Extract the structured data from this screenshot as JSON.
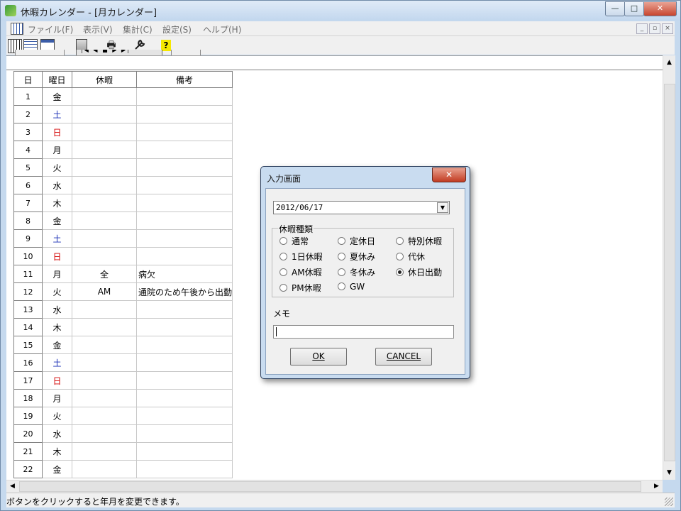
{
  "window": {
    "title": "休暇カレンダー - [月カレンダー]",
    "controls": {
      "minimize": "—",
      "maximize": "□",
      "close": "✕"
    }
  },
  "menu": {
    "items": [
      "ファイル(F)",
      "表示(V)",
      "集計(C)",
      "設定(S)",
      "ヘルプ(H)"
    ],
    "mdi": {
      "minimize": "_",
      "restore": "▫",
      "close": "×"
    }
  },
  "toolbar": {
    "print_glyph": "🖶",
    "help_glyph": "?",
    "nav_glyphs": "|◀ ◀ ■ ▶ ▶|"
  },
  "calendar": {
    "headers": [
      "日",
      "曜日",
      "休暇",
      "備考"
    ],
    "rows": [
      {
        "day": "1",
        "weekday": "金",
        "type": "",
        "vacation": "",
        "note": ""
      },
      {
        "day": "2",
        "weekday": "土",
        "type": "sat",
        "vacation": "",
        "note": ""
      },
      {
        "day": "3",
        "weekday": "日",
        "type": "sun",
        "vacation": "",
        "note": ""
      },
      {
        "day": "4",
        "weekday": "月",
        "type": "",
        "vacation": "",
        "note": ""
      },
      {
        "day": "5",
        "weekday": "火",
        "type": "",
        "vacation": "",
        "note": ""
      },
      {
        "day": "6",
        "weekday": "水",
        "type": "",
        "vacation": "",
        "note": ""
      },
      {
        "day": "7",
        "weekday": "木",
        "type": "",
        "vacation": "",
        "note": ""
      },
      {
        "day": "8",
        "weekday": "金",
        "type": "",
        "vacation": "",
        "note": ""
      },
      {
        "day": "9",
        "weekday": "土",
        "type": "sat",
        "vacation": "",
        "note": ""
      },
      {
        "day": "10",
        "weekday": "日",
        "type": "sun",
        "vacation": "",
        "note": ""
      },
      {
        "day": "11",
        "weekday": "月",
        "type": "",
        "vacation": "全",
        "note": "病欠"
      },
      {
        "day": "12",
        "weekday": "火",
        "type": "",
        "vacation": "AM",
        "note": "通院のため午後から出勤"
      },
      {
        "day": "13",
        "weekday": "水",
        "type": "",
        "vacation": "",
        "note": ""
      },
      {
        "day": "14",
        "weekday": "木",
        "type": "",
        "vacation": "",
        "note": ""
      },
      {
        "day": "15",
        "weekday": "金",
        "type": "",
        "vacation": "",
        "note": ""
      },
      {
        "day": "16",
        "weekday": "土",
        "type": "sat",
        "vacation": "",
        "note": ""
      },
      {
        "day": "17",
        "weekday": "日",
        "type": "sun",
        "vacation": "",
        "note": ""
      },
      {
        "day": "18",
        "weekday": "月",
        "type": "",
        "vacation": "",
        "note": ""
      },
      {
        "day": "19",
        "weekday": "火",
        "type": "",
        "vacation": "",
        "note": ""
      },
      {
        "day": "20",
        "weekday": "水",
        "type": "",
        "vacation": "",
        "note": ""
      },
      {
        "day": "21",
        "weekday": "木",
        "type": "",
        "vacation": "",
        "note": ""
      },
      {
        "day": "22",
        "weekday": "金",
        "type": "",
        "vacation": "",
        "note": ""
      }
    ],
    "colors": {
      "saturday": "#1a2fb5",
      "sunday": "#d40000"
    }
  },
  "scrollbar": {
    "up": "▲",
    "down": "▼",
    "left": "◀",
    "right": "▶"
  },
  "status": {
    "text": "ボタンをクリックすると年月を変更できます。"
  },
  "dialog": {
    "title": "入力画面",
    "close": "✕",
    "date_value": "2012/06/17",
    "dropdown_arrow": "▼",
    "group_label": "休暇種類",
    "options": [
      {
        "label": "通常",
        "selected": false
      },
      {
        "label": "定休日",
        "selected": false
      },
      {
        "label": "特別休暇",
        "selected": false
      },
      {
        "label": "1日休暇",
        "selected": false
      },
      {
        "label": "夏休み",
        "selected": false
      },
      {
        "label": "代休",
        "selected": false
      },
      {
        "label": "AM休暇",
        "selected": false
      },
      {
        "label": "冬休み",
        "selected": false
      },
      {
        "label": "休日出勤",
        "selected": true
      },
      {
        "label": "PM休暇",
        "selected": false
      },
      {
        "label": "GW",
        "selected": false
      }
    ],
    "memo_label": "メモ",
    "memo_value": "",
    "ok_label": "OK",
    "cancel_label": "CANCEL"
  }
}
